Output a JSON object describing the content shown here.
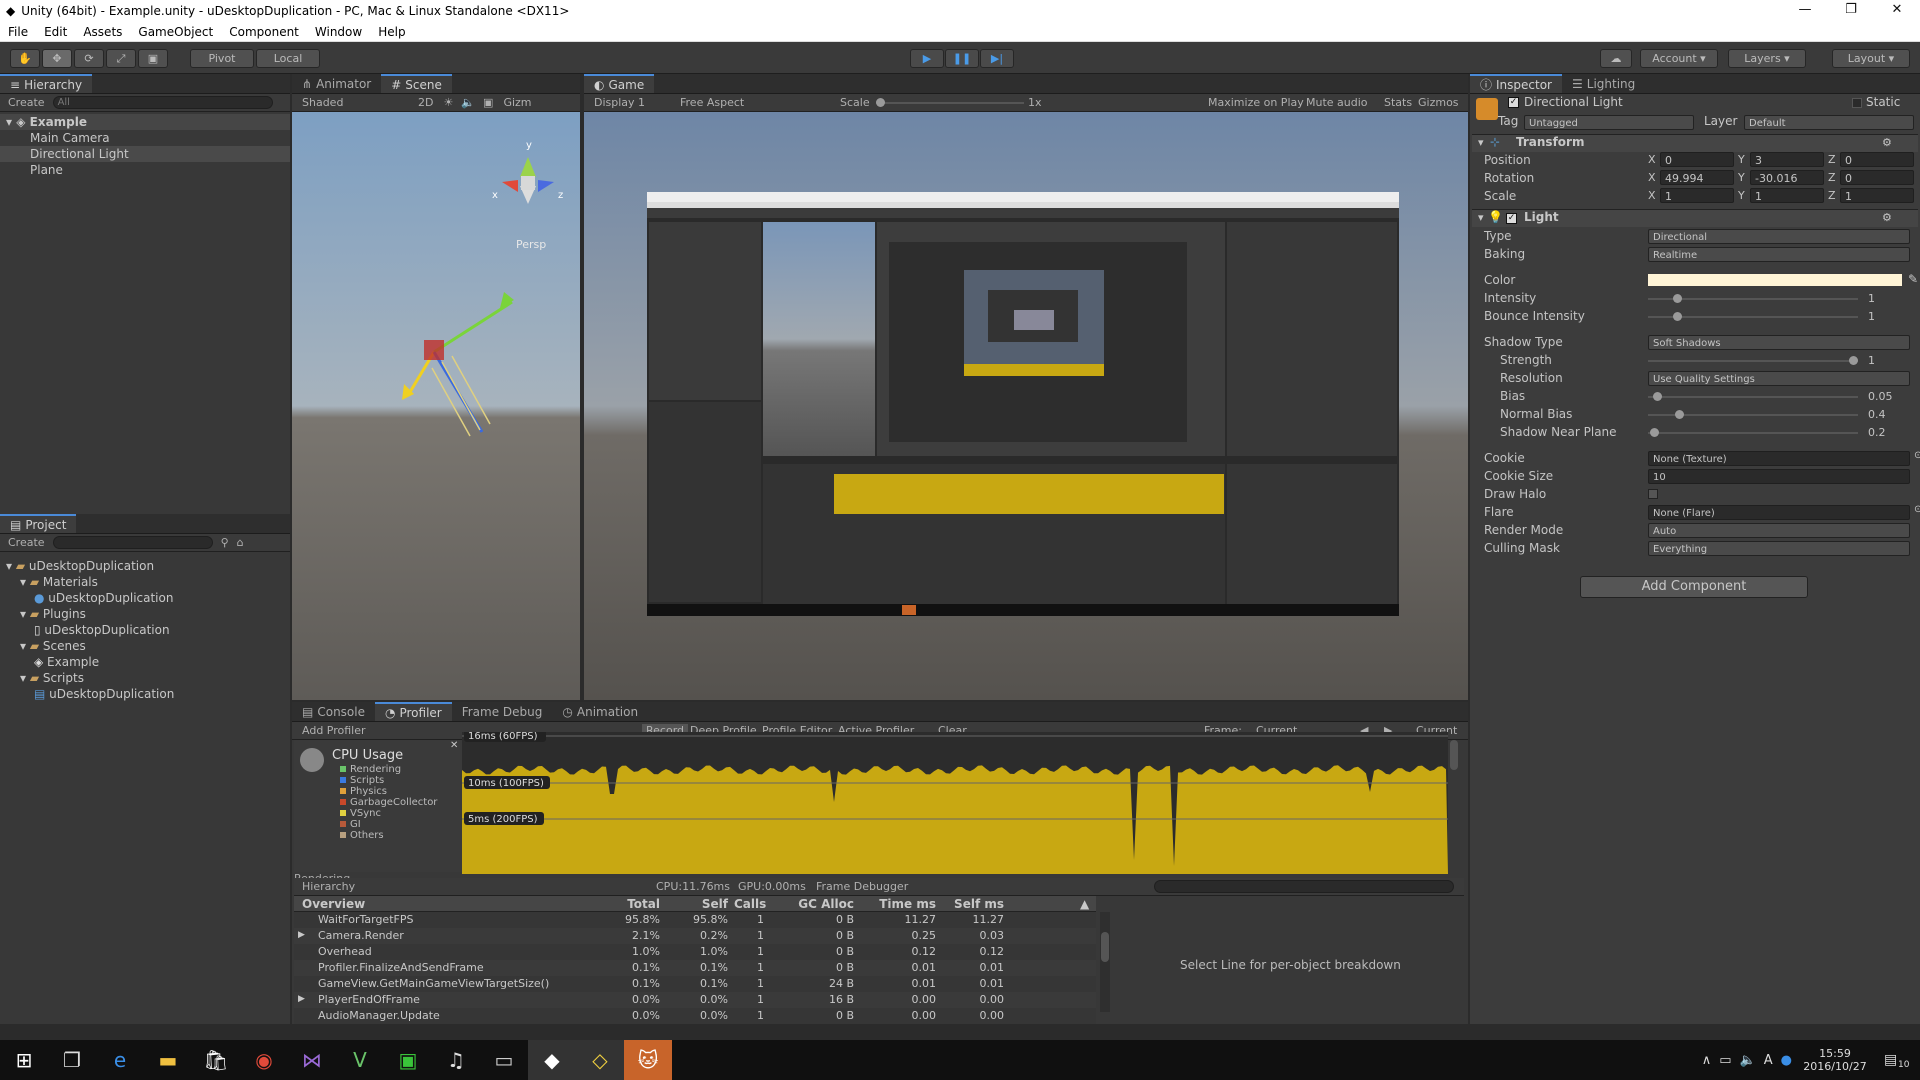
{
  "window": {
    "title": "Unity (64bit) - Example.unity - uDesktopDuplication - PC, Mac & Linux Standalone <DX11>"
  },
  "menu": [
    "File",
    "Edit",
    "Assets",
    "GameObject",
    "Component",
    "Window",
    "Help"
  ],
  "toolbar": {
    "pivot": "Pivot",
    "local": "Local",
    "account": "Account",
    "layers": "Layers",
    "layout": "Layout"
  },
  "hierarchy": {
    "tab": "Hierarchy",
    "create": "Create",
    "search": "All",
    "scene": "Example",
    "items": [
      "Main Camera",
      "Directional Light",
      "Plane"
    ]
  },
  "scene": {
    "tabs": [
      "Animator",
      "Scene"
    ],
    "shaded": "Shaded",
    "mode2d": "2D",
    "gizmos": "Gizm",
    "persp": "Persp",
    "axis_y": "y",
    "axis_x": "x",
    "axis_z": "z"
  },
  "game": {
    "tab": "Game",
    "display": "Display 1",
    "aspect": "Free Aspect",
    "scale": "Scale",
    "scale_val": "1x",
    "maximize": "Maximize on Play",
    "mute": "Mute audio",
    "stats": "Stats",
    "gizmos": "Gizmos"
  },
  "project": {
    "tab": "Project",
    "create": "Create",
    "tree": [
      {
        "label": "uDesktopDuplication",
        "indent": 0,
        "type": "folder"
      },
      {
        "label": "Materials",
        "indent": 1,
        "type": "folder"
      },
      {
        "label": "uDesktopDuplication",
        "indent": 2,
        "type": "material"
      },
      {
        "label": "Plugins",
        "indent": 1,
        "type": "folder"
      },
      {
        "label": "uDesktopDuplication",
        "indent": 2,
        "type": "file"
      },
      {
        "label": "Scenes",
        "indent": 1,
        "type": "folder"
      },
      {
        "label": "Example",
        "indent": 2,
        "type": "scene"
      },
      {
        "label": "Scripts",
        "indent": 1,
        "type": "folder"
      },
      {
        "label": "uDesktopDuplication",
        "indent": 2,
        "type": "script"
      }
    ]
  },
  "inspector": {
    "tabs": [
      "Inspector",
      "Lighting"
    ],
    "object_name": "Directional Light",
    "static": "Static",
    "tag_label": "Tag",
    "tag": "Untagged",
    "layer_label": "Layer",
    "layer": "Default",
    "transform": {
      "title": "Transform",
      "position": "Position",
      "rotation": "Rotation",
      "scale": "Scale",
      "pos": [
        "0",
        "3",
        "0"
      ],
      "rot": [
        "49.994",
        "-30.016",
        "0"
      ],
      "scl": [
        "1",
        "1",
        "1"
      ]
    },
    "light": {
      "title": "Light",
      "rows": [
        {
          "label": "Type",
          "value": "Directional",
          "kind": "dropdown"
        },
        {
          "label": "Baking",
          "value": "Realtime",
          "kind": "dropdown"
        },
        {
          "label": "Color",
          "value": "",
          "kind": "color"
        },
        {
          "label": "Intensity",
          "value": "1",
          "kind": "slider",
          "level": 0.125
        },
        {
          "label": "Bounce Intensity",
          "value": "1",
          "kind": "slider",
          "level": 0.125
        },
        {
          "label": "Shadow Type",
          "value": "Soft Shadows",
          "kind": "dropdown"
        },
        {
          "label": "Strength",
          "value": "1",
          "kind": "slider",
          "level": 1
        },
        {
          "label": "Resolution",
          "value": "Use Quality Settings",
          "kind": "dropdown"
        },
        {
          "label": "Bias",
          "value": "0.05",
          "kind": "slider",
          "level": 0.025
        },
        {
          "label": "Normal Bias",
          "value": "0.4",
          "kind": "slider",
          "level": 0.133
        },
        {
          "label": "Shadow Near Plane",
          "value": "0.2",
          "kind": "slider",
          "level": 0.01
        },
        {
          "label": "Cookie",
          "value": "None (Texture)",
          "kind": "object"
        },
        {
          "label": "Cookie Size",
          "value": "10",
          "kind": "field"
        },
        {
          "label": "Draw Halo",
          "value": "",
          "kind": "check"
        },
        {
          "label": "Flare",
          "value": "None (Flare)",
          "kind": "object"
        },
        {
          "label": "Render Mode",
          "value": "Auto",
          "kind": "dropdown"
        },
        {
          "label": "Culling Mask",
          "value": "Everything",
          "kind": "dropdown"
        }
      ]
    },
    "add_component": "Add Component"
  },
  "profiler": {
    "tabs": [
      "Console",
      "Profiler",
      "Frame Debug",
      "Animation"
    ],
    "add": "Add Profiler",
    "record": "Record",
    "deep": "Deep Profile",
    "editor": "Profile Editor",
    "active": "Active Profiler",
    "clear": "Clear",
    "frame_label": "Frame:",
    "frame_val": "Current",
    "current": "Current",
    "cpu_title": "CPU Usage",
    "legend": [
      "Rendering",
      "Scripts",
      "Physics",
      "GarbageCollector",
      "VSync",
      "GI",
      "Others"
    ],
    "rendering": "Rendering",
    "markers": [
      "16ms (60FPS)",
      "10ms (100FPS)",
      "5ms (200FPS)"
    ],
    "hier": "Hierarchy",
    "cpu": "CPU:11.76ms",
    "gpu": "GPU:0.00ms",
    "fdbg": "Frame Debugger",
    "cols": [
      "Overview",
      "Total",
      "Self",
      "Calls",
      "GC Alloc",
      "Time ms",
      "Self ms"
    ],
    "rows": [
      [
        "WaitForTargetFPS",
        "95.8%",
        "95.8%",
        "1",
        "0 B",
        "11.27",
        "11.27"
      ],
      [
        "Camera.Render",
        "2.1%",
        "0.2%",
        "1",
        "0 B",
        "0.25",
        "0.03"
      ],
      [
        "Overhead",
        "1.0%",
        "1.0%",
        "1",
        "0 B",
        "0.12",
        "0.12"
      ],
      [
        "Profiler.FinalizeAndSendFrame",
        "0.1%",
        "0.1%",
        "1",
        "0 B",
        "0.01",
        "0.01"
      ],
      [
        "GameView.GetMainGameViewTargetSize()",
        "0.1%",
        "0.1%",
        "1",
        "24 B",
        "0.01",
        "0.01"
      ],
      [
        "PlayerEndOfFrame",
        "0.0%",
        "0.0%",
        "1",
        "16 B",
        "0.00",
        "0.00"
      ],
      [
        "AudioManager.Update",
        "0.0%",
        "0.0%",
        "1",
        "0 B",
        "0.00",
        "0.00"
      ]
    ],
    "detail": "Select Line for per-object breakdown"
  },
  "taskbar": {
    "time": "15:59",
    "date": "2016/10/27",
    "badge": "10"
  },
  "colors": {
    "accent": "#4a8ad8",
    "graph": "#c8a812",
    "selection": "#3e5f96"
  }
}
